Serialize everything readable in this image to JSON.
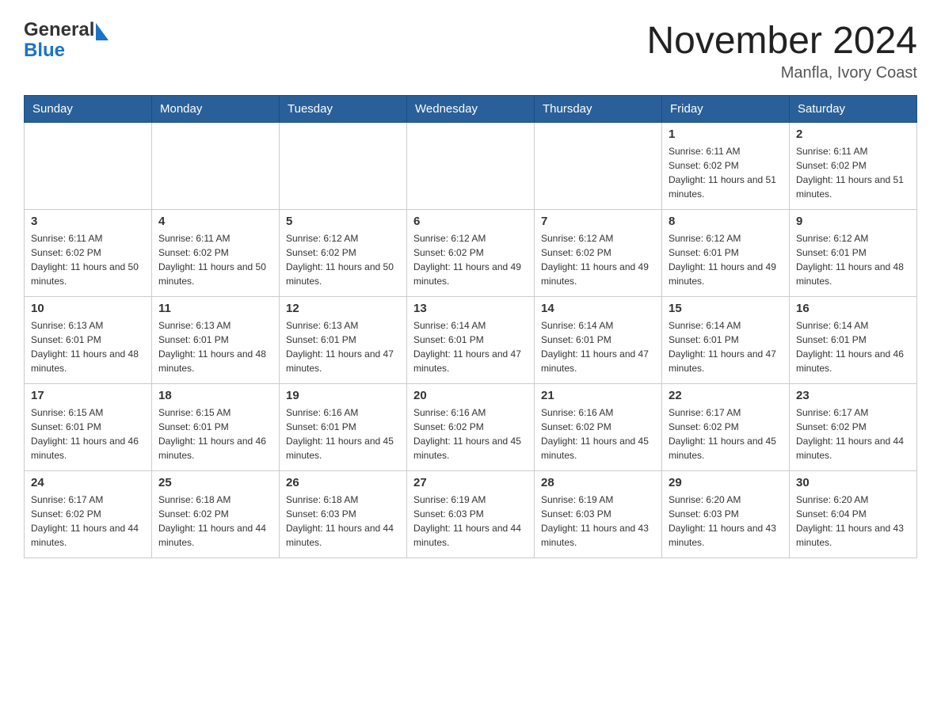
{
  "header": {
    "logo_general": "General",
    "logo_blue": "Blue",
    "month_title": "November 2024",
    "location": "Manfla, Ivory Coast"
  },
  "days_of_week": [
    "Sunday",
    "Monday",
    "Tuesday",
    "Wednesday",
    "Thursday",
    "Friday",
    "Saturday"
  ],
  "weeks": [
    [
      {
        "day": "",
        "info": ""
      },
      {
        "day": "",
        "info": ""
      },
      {
        "day": "",
        "info": ""
      },
      {
        "day": "",
        "info": ""
      },
      {
        "day": "",
        "info": ""
      },
      {
        "day": "1",
        "info": "Sunrise: 6:11 AM\nSunset: 6:02 PM\nDaylight: 11 hours and 51 minutes."
      },
      {
        "day": "2",
        "info": "Sunrise: 6:11 AM\nSunset: 6:02 PM\nDaylight: 11 hours and 51 minutes."
      }
    ],
    [
      {
        "day": "3",
        "info": "Sunrise: 6:11 AM\nSunset: 6:02 PM\nDaylight: 11 hours and 50 minutes."
      },
      {
        "day": "4",
        "info": "Sunrise: 6:11 AM\nSunset: 6:02 PM\nDaylight: 11 hours and 50 minutes."
      },
      {
        "day": "5",
        "info": "Sunrise: 6:12 AM\nSunset: 6:02 PM\nDaylight: 11 hours and 50 minutes."
      },
      {
        "day": "6",
        "info": "Sunrise: 6:12 AM\nSunset: 6:02 PM\nDaylight: 11 hours and 49 minutes."
      },
      {
        "day": "7",
        "info": "Sunrise: 6:12 AM\nSunset: 6:02 PM\nDaylight: 11 hours and 49 minutes."
      },
      {
        "day": "8",
        "info": "Sunrise: 6:12 AM\nSunset: 6:01 PM\nDaylight: 11 hours and 49 minutes."
      },
      {
        "day": "9",
        "info": "Sunrise: 6:12 AM\nSunset: 6:01 PM\nDaylight: 11 hours and 48 minutes."
      }
    ],
    [
      {
        "day": "10",
        "info": "Sunrise: 6:13 AM\nSunset: 6:01 PM\nDaylight: 11 hours and 48 minutes."
      },
      {
        "day": "11",
        "info": "Sunrise: 6:13 AM\nSunset: 6:01 PM\nDaylight: 11 hours and 48 minutes."
      },
      {
        "day": "12",
        "info": "Sunrise: 6:13 AM\nSunset: 6:01 PM\nDaylight: 11 hours and 47 minutes."
      },
      {
        "day": "13",
        "info": "Sunrise: 6:14 AM\nSunset: 6:01 PM\nDaylight: 11 hours and 47 minutes."
      },
      {
        "day": "14",
        "info": "Sunrise: 6:14 AM\nSunset: 6:01 PM\nDaylight: 11 hours and 47 minutes."
      },
      {
        "day": "15",
        "info": "Sunrise: 6:14 AM\nSunset: 6:01 PM\nDaylight: 11 hours and 47 minutes."
      },
      {
        "day": "16",
        "info": "Sunrise: 6:14 AM\nSunset: 6:01 PM\nDaylight: 11 hours and 46 minutes."
      }
    ],
    [
      {
        "day": "17",
        "info": "Sunrise: 6:15 AM\nSunset: 6:01 PM\nDaylight: 11 hours and 46 minutes."
      },
      {
        "day": "18",
        "info": "Sunrise: 6:15 AM\nSunset: 6:01 PM\nDaylight: 11 hours and 46 minutes."
      },
      {
        "day": "19",
        "info": "Sunrise: 6:16 AM\nSunset: 6:01 PM\nDaylight: 11 hours and 45 minutes."
      },
      {
        "day": "20",
        "info": "Sunrise: 6:16 AM\nSunset: 6:02 PM\nDaylight: 11 hours and 45 minutes."
      },
      {
        "day": "21",
        "info": "Sunrise: 6:16 AM\nSunset: 6:02 PM\nDaylight: 11 hours and 45 minutes."
      },
      {
        "day": "22",
        "info": "Sunrise: 6:17 AM\nSunset: 6:02 PM\nDaylight: 11 hours and 45 minutes."
      },
      {
        "day": "23",
        "info": "Sunrise: 6:17 AM\nSunset: 6:02 PM\nDaylight: 11 hours and 44 minutes."
      }
    ],
    [
      {
        "day": "24",
        "info": "Sunrise: 6:17 AM\nSunset: 6:02 PM\nDaylight: 11 hours and 44 minutes."
      },
      {
        "day": "25",
        "info": "Sunrise: 6:18 AM\nSunset: 6:02 PM\nDaylight: 11 hours and 44 minutes."
      },
      {
        "day": "26",
        "info": "Sunrise: 6:18 AM\nSunset: 6:03 PM\nDaylight: 11 hours and 44 minutes."
      },
      {
        "day": "27",
        "info": "Sunrise: 6:19 AM\nSunset: 6:03 PM\nDaylight: 11 hours and 44 minutes."
      },
      {
        "day": "28",
        "info": "Sunrise: 6:19 AM\nSunset: 6:03 PM\nDaylight: 11 hours and 43 minutes."
      },
      {
        "day": "29",
        "info": "Sunrise: 6:20 AM\nSunset: 6:03 PM\nDaylight: 11 hours and 43 minutes."
      },
      {
        "day": "30",
        "info": "Sunrise: 6:20 AM\nSunset: 6:04 PM\nDaylight: 11 hours and 43 minutes."
      }
    ]
  ]
}
